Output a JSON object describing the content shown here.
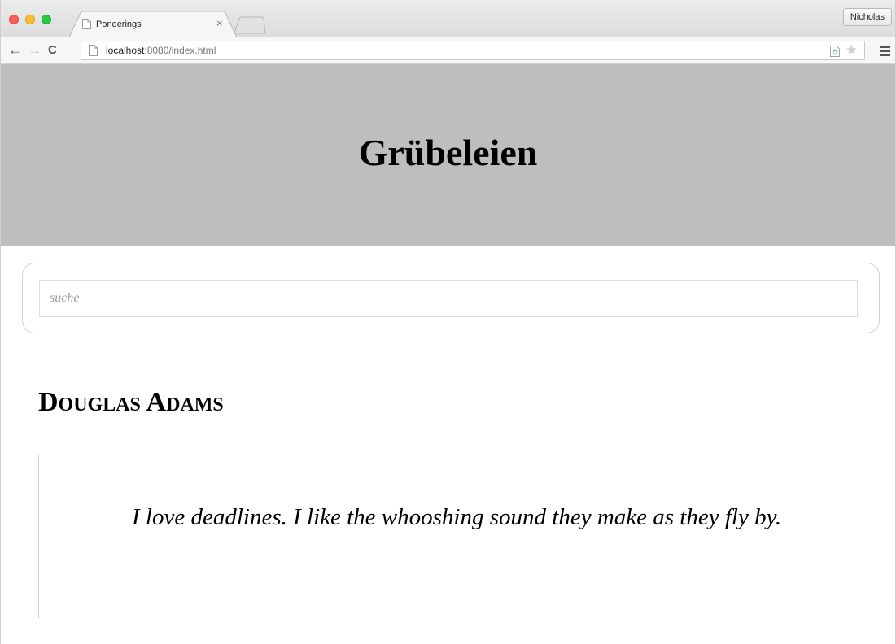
{
  "browser": {
    "tab": {
      "title": "Ponderings",
      "close_glyph": "×"
    },
    "profile_name": "Nicholas",
    "url": {
      "host": "localhost",
      "rest": ":8080/index.html"
    },
    "icons": [
      "back-arrow-icon",
      "forward-arrow-icon",
      "reload-icon",
      "page-icon",
      "reader-mode-icon",
      "star-icon",
      "menu-icon"
    ]
  },
  "page": {
    "site_title": "Grübeleien",
    "search": {
      "placeholder": "suche",
      "value": ""
    },
    "author": "Douglas Adams",
    "quote": "I love deadlines. I like the whooshing sound they make as they fly by."
  },
  "colors": {
    "banner": "#bebebe",
    "traffic_red": "#fc5f57",
    "traffic_yellow": "#fdbc2e",
    "traffic_green": "#28c840"
  }
}
